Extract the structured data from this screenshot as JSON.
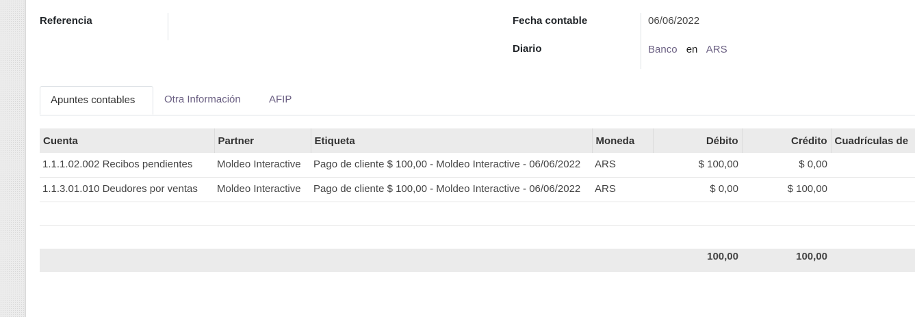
{
  "form": {
    "reference_label": "Referencia",
    "reference_value": "",
    "date_label": "Fecha contable",
    "date_value": "06/06/2022",
    "journal_label": "Diario",
    "journal_value": "Banco",
    "journal_in": "en",
    "journal_currency": "ARS"
  },
  "tabs": [
    {
      "label": "Apuntes contables"
    },
    {
      "label": "Otra Información"
    },
    {
      "label": "AFIP"
    }
  ],
  "table": {
    "headers": [
      "Cuenta",
      "Partner",
      "Etiqueta",
      "Moneda",
      "Débito",
      "Crédito",
      "Cuadrículas de"
    ],
    "rows": [
      {
        "cuenta": "1.1.1.02.002 Recibos pendientes",
        "partner": "Moldeo Interactive",
        "etiqueta": "Pago de cliente $ 100,00 - Moldeo Interactive - 06/06/2022",
        "moneda": "ARS",
        "debito": "$ 100,00",
        "credito": "$ 0,00"
      },
      {
        "cuenta": "1.1.3.01.010 Deudores por ventas",
        "partner": "Moldeo Interactive",
        "etiqueta": "Pago de cliente $ 100,00 - Moldeo Interactive - 06/06/2022",
        "moneda": "ARS",
        "debito": "$ 0,00",
        "credito": "$ 100,00"
      }
    ],
    "totals": {
      "debito": "100,00",
      "credito": "100,00"
    }
  }
}
